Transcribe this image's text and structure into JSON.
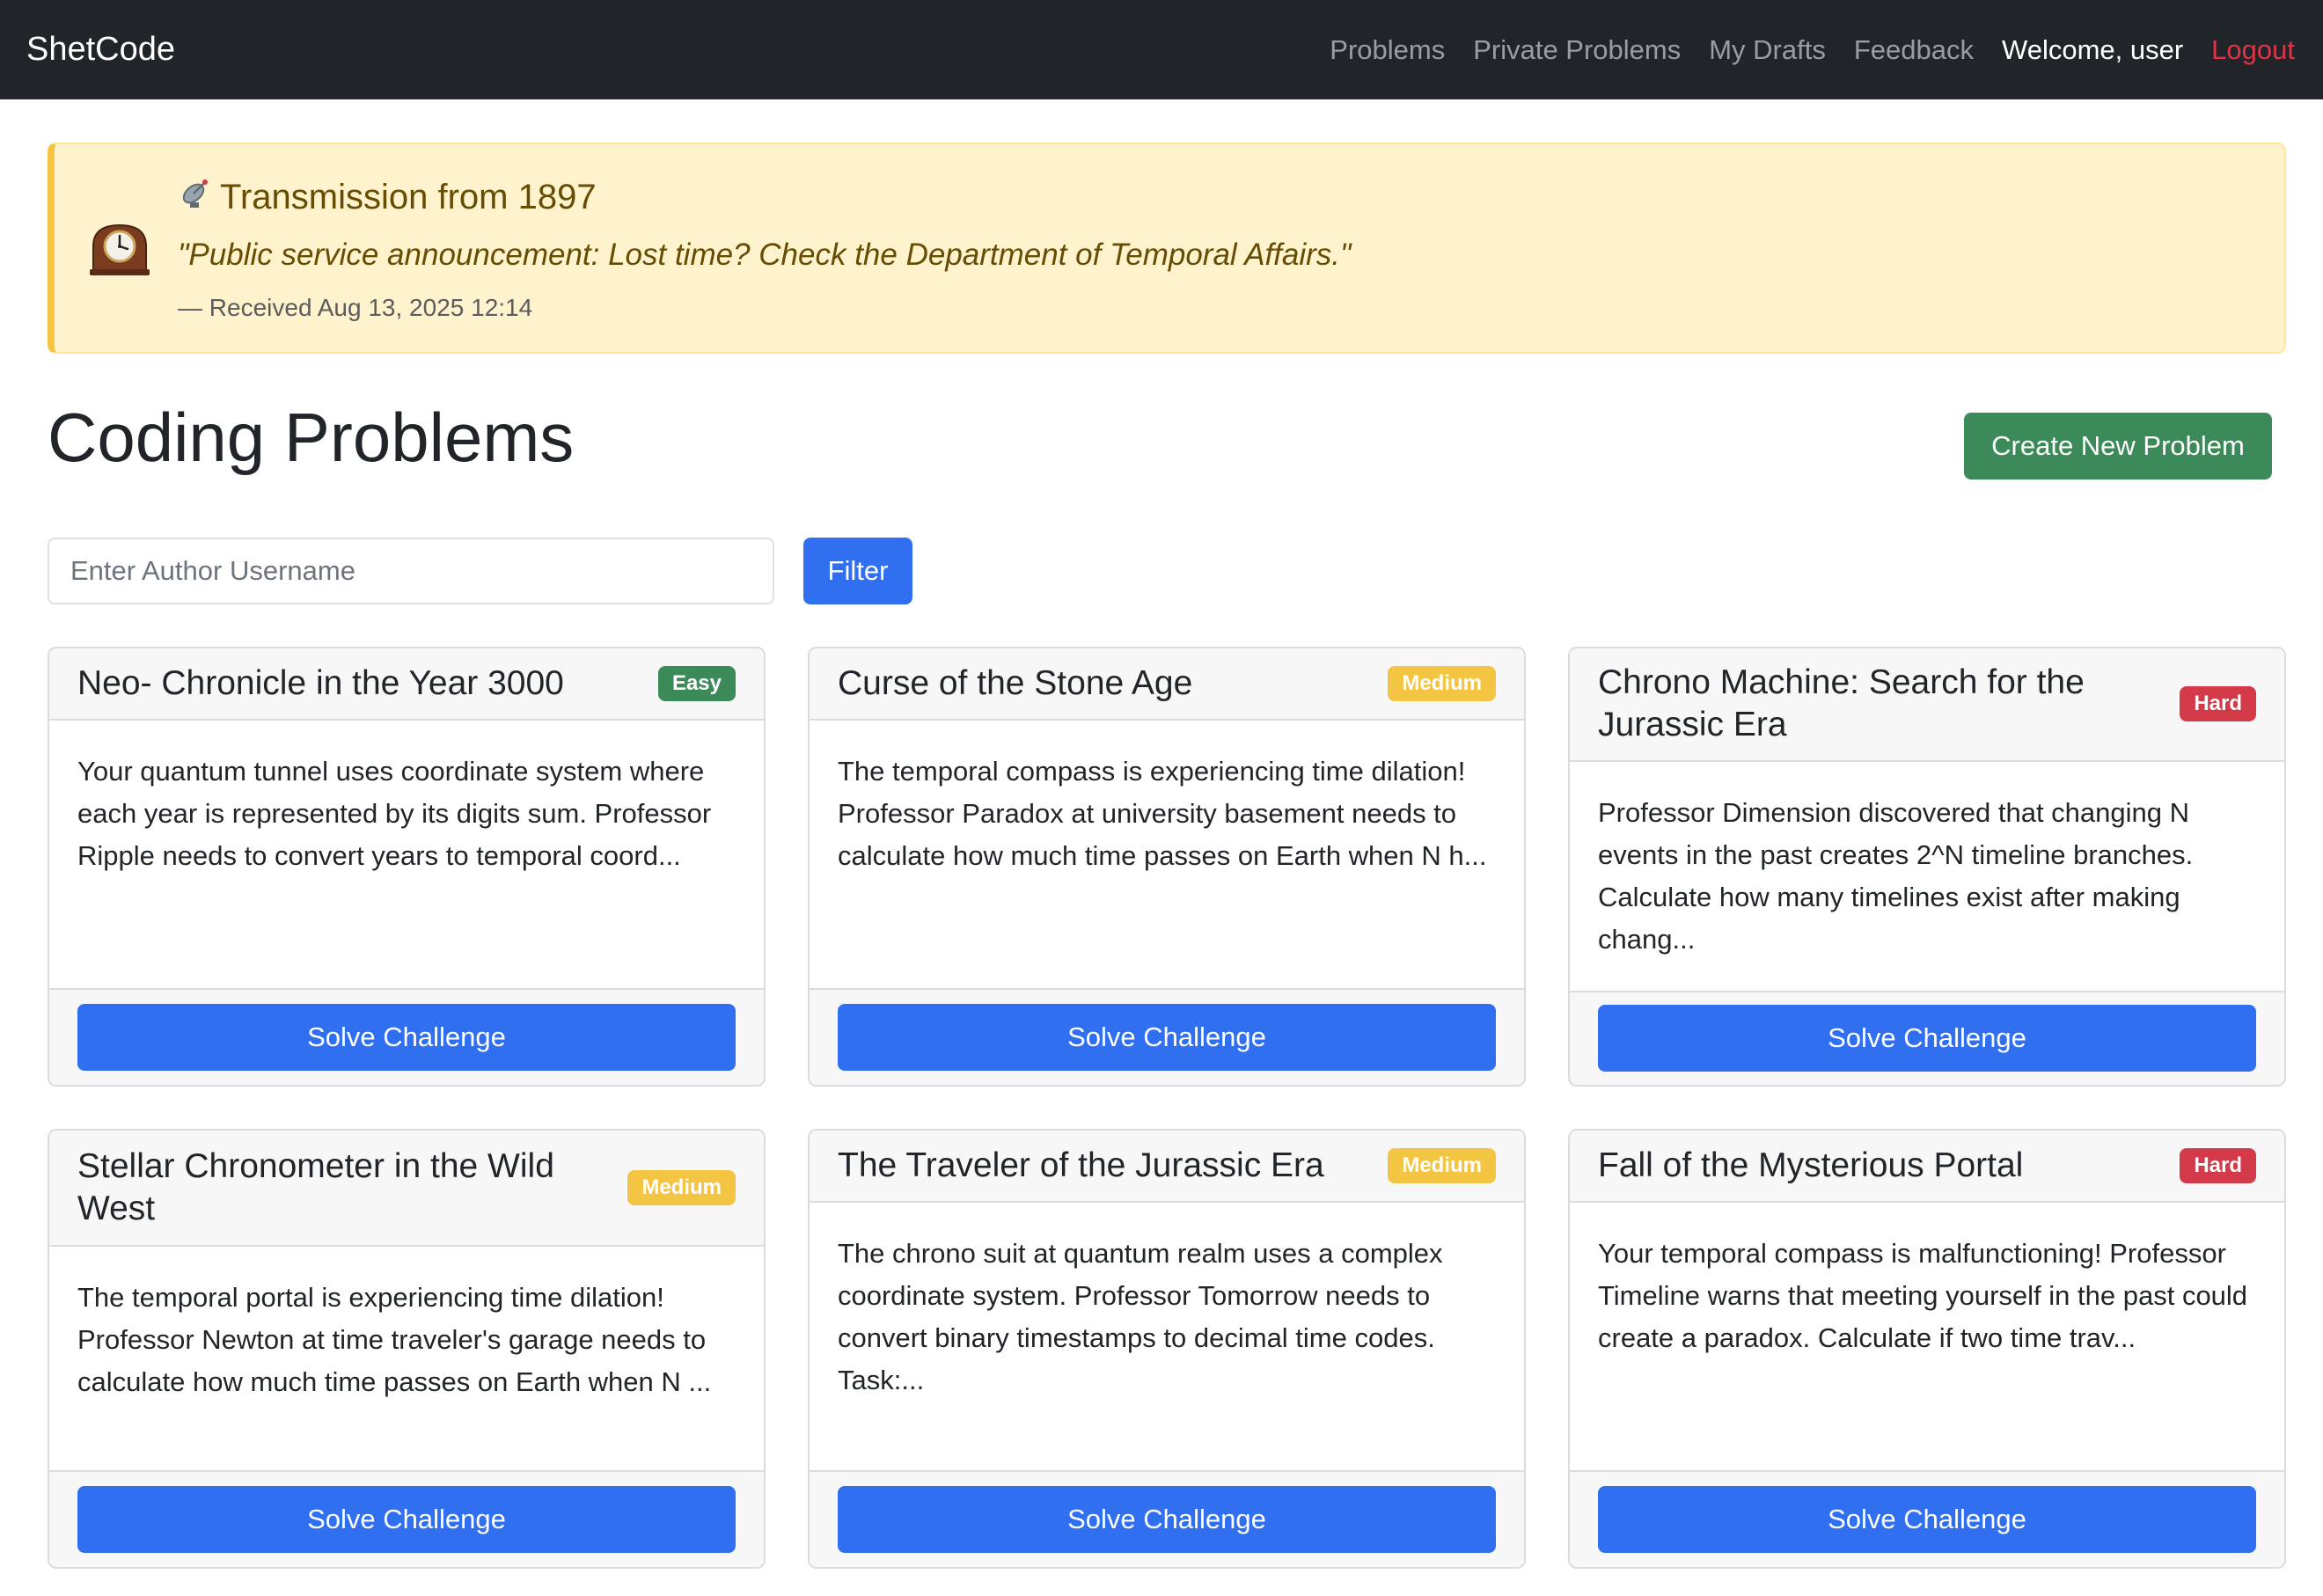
{
  "navbar": {
    "brand": "ShetCode",
    "links": [
      "Problems",
      "Private Problems",
      "My Drafts",
      "Feedback"
    ],
    "welcome": "Welcome, user",
    "logout": "Logout"
  },
  "alert": {
    "clock_emoji": "🕰️",
    "dish_emoji": "📡",
    "title": "Transmission from 1897",
    "quote": "\"Public service announcement: Lost time? Check the Department of Temporal Affairs.\"",
    "meta": "— Received Aug 13, 2025 12:14"
  },
  "page": {
    "title": "Coding Problems",
    "create_button": "Create New Problem"
  },
  "filter": {
    "placeholder": "Enter Author Username",
    "value": "",
    "button": "Filter"
  },
  "cards": [
    {
      "title": "Neo- Chronicle in the Year 3000",
      "difficulty": "Easy",
      "description": "Your quantum tunnel uses coordinate system where each year is represented by its digits sum. Professor Ripple needs to convert years to temporal coord...",
      "button": "Solve Challenge"
    },
    {
      "title": "Curse of the Stone Age",
      "difficulty": "Medium",
      "description": "The temporal compass is experiencing time dilation! Professor Paradox at university basement needs to calculate how much time passes on Earth when N h...",
      "button": "Solve Challenge"
    },
    {
      "title": "Chrono Machine: Search for the Jurassic Era",
      "difficulty": "Hard",
      "description": "Professor Dimension discovered that changing N events in the past creates 2^N timeline branches. Calculate how many timelines exist after making chang...",
      "button": "Solve Challenge"
    },
    {
      "title": "Stellar Chronometer in the Wild West",
      "difficulty": "Medium",
      "description": "The temporal portal is experiencing time dilation! Professor Newton at time traveler's garage needs to calculate how much time passes on Earth when N ...",
      "button": "Solve Challenge"
    },
    {
      "title": "The Traveler of the Jurassic Era",
      "difficulty": "Medium",
      "description": "The chrono suit at quantum realm uses a complex coordinate system. Professor Tomorrow needs to convert binary timestamps to decimal time codes. Task:...",
      "button": "Solve Challenge"
    },
    {
      "title": "Fall of the Mysterious Portal",
      "difficulty": "Hard",
      "description": "Your temporal compass is malfunctioning! Professor Timeline warns that meeting yourself in the past could create a paradox. Calculate if two time trav...",
      "button": "Solve Challenge"
    }
  ],
  "colors": {
    "navbar_bg": "#212529",
    "primary": "#2f6ff0",
    "success": "#3c8a5a",
    "warning": "#f4c542",
    "danger": "#d33a4a",
    "alert_bg": "#fff3cd"
  }
}
